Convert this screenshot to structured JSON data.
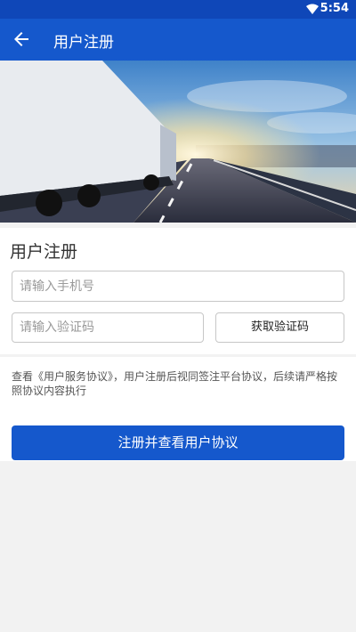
{
  "statusbar": {
    "time": "5:54"
  },
  "appbar": {
    "title": "用户注册"
  },
  "form": {
    "heading": "用户注册",
    "phone_placeholder": "请输入手机号",
    "code_placeholder": "请输入验证码",
    "get_code_label": "获取验证码"
  },
  "notice": {
    "text": "查看《用户服务协议》，用户注册后视同签注平台协议，后续请严格按照协议内容执行"
  },
  "submit": {
    "label": "注册并查看用户协议"
  },
  "colors": {
    "primary": "#1558cc",
    "statusbar": "#0f47b8"
  }
}
